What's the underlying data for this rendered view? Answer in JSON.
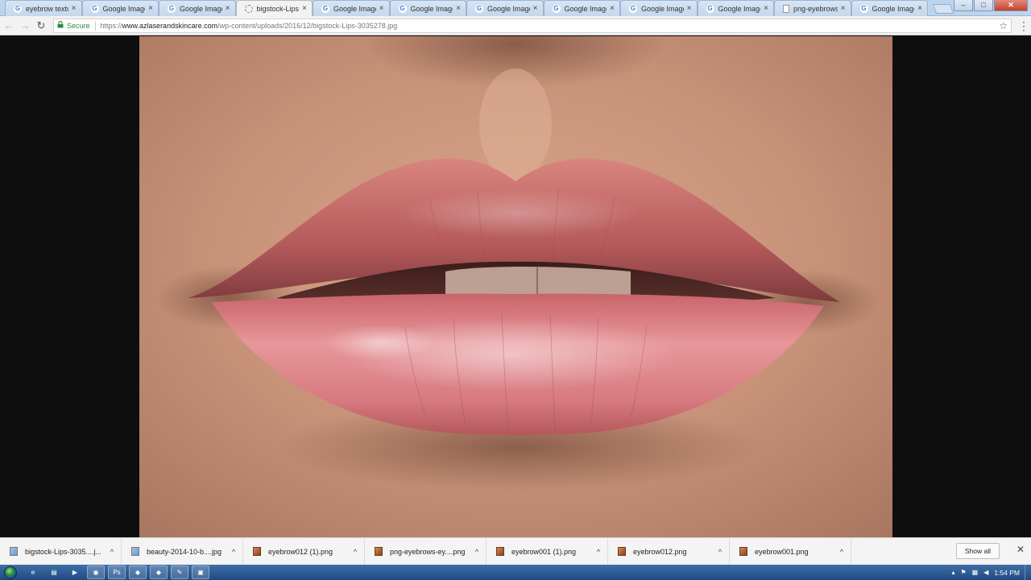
{
  "browser": {
    "tabs": [
      {
        "title": "eyebrow textu",
        "icon": "google-icon",
        "active": false
      },
      {
        "title": "Google Image",
        "icon": "google-icon",
        "active": false
      },
      {
        "title": "Google Image",
        "icon": "google-icon",
        "active": false
      },
      {
        "title": "bigstock-Lips-3",
        "icon": "loading-icon",
        "active": true
      },
      {
        "title": "Google Image",
        "icon": "google-icon",
        "active": false
      },
      {
        "title": "Google Image",
        "icon": "google-icon",
        "active": false
      },
      {
        "title": "Google Image",
        "icon": "google-icon",
        "active": false
      },
      {
        "title": "Google Image",
        "icon": "google-icon",
        "active": false
      },
      {
        "title": "Google Image",
        "icon": "google-icon",
        "active": false
      },
      {
        "title": "Google Image",
        "icon": "google-icon",
        "active": false
      },
      {
        "title": "png-eyebrows",
        "icon": "document-icon",
        "active": false
      },
      {
        "title": "Google Image",
        "icon": "google-icon",
        "active": false
      }
    ],
    "tab_close_glyph": "×",
    "window_controls": {
      "minimize": "–",
      "maximize": "□",
      "close": "✕"
    },
    "toolbar": {
      "back_glyph": "←",
      "forward_glyph": "→",
      "reload_glyph": "↻",
      "secure_label": "Secure",
      "url_scheme": "https://",
      "url_host": "www.azlaserandskincare.com",
      "url_path": "/wp-content/uploads/2016/12/bigstock-Lips-3035278.jpg",
      "star_glyph": "☆",
      "menu_glyph": "⋮"
    }
  },
  "downloads": {
    "items": [
      {
        "name": "bigstock-Lips-3035....j...",
        "icon": "image-file-icon",
        "type": "jpg"
      },
      {
        "name": "beauty-2014-10-b....jpg",
        "icon": "image-file-icon",
        "type": "jpg"
      },
      {
        "name": "eyebrow012 (1).png",
        "icon": "png-file-icon",
        "type": "png"
      },
      {
        "name": "png-eyebrows-ey....png",
        "icon": "png-file-icon",
        "type": "png"
      },
      {
        "name": "eyebrow001 (1).png",
        "icon": "png-file-icon",
        "type": "png"
      },
      {
        "name": "eyebrow012.png",
        "icon": "png-file-icon",
        "type": "png"
      },
      {
        "name": "eyebrow001.png",
        "icon": "png-file-icon",
        "type": "png"
      }
    ],
    "caret_glyph": "^",
    "show_all_label": "Show all",
    "close_glyph": "✕"
  },
  "taskbar": {
    "apps": [
      {
        "name": "internet-explorer-icon",
        "glyph": "e",
        "open": false
      },
      {
        "name": "file-explorer-icon",
        "glyph": "▤",
        "open": false
      },
      {
        "name": "media-player-icon",
        "glyph": "▶",
        "open": false
      },
      {
        "name": "chrome-icon",
        "glyph": "◉",
        "open": true
      },
      {
        "name": "photoshop-icon",
        "glyph": "Ps",
        "open": true
      },
      {
        "name": "app-icon-1",
        "glyph": "◆",
        "open": true
      },
      {
        "name": "app-icon-2",
        "glyph": "◆",
        "open": true
      },
      {
        "name": "app-icon-3",
        "glyph": "✎",
        "open": true
      },
      {
        "name": "app-icon-4",
        "glyph": "▣",
        "open": true
      }
    ],
    "tray": {
      "clock": "1:54 PM",
      "up_glyph": "▴"
    }
  }
}
